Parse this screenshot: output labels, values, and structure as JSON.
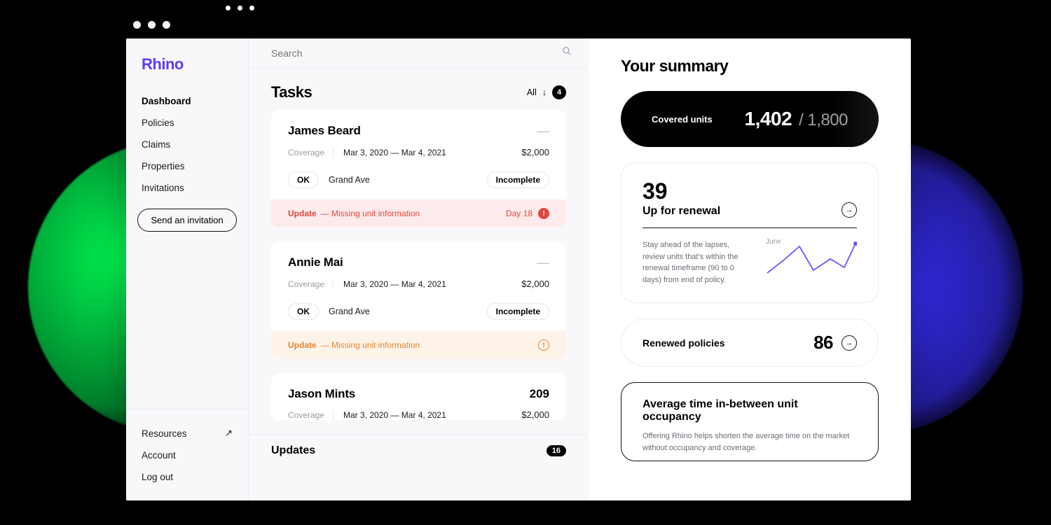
{
  "brand": "Rhino",
  "sidebar": {
    "items": [
      {
        "label": "Dashboard",
        "active": true
      },
      {
        "label": "Policies"
      },
      {
        "label": "Claims"
      },
      {
        "label": "Properties"
      },
      {
        "label": "Invitations"
      }
    ],
    "cta": "Send an invitation",
    "bottom": {
      "resources": "Resources",
      "account": "Account",
      "logout": "Log out"
    }
  },
  "search": {
    "placeholder": "Search"
  },
  "tasks": {
    "title": "Tasks",
    "filter_label": "All",
    "count": "4",
    "items": [
      {
        "name": "James Beard",
        "metric": "—",
        "coverage_label": "Coverage",
        "dates": "Mar 3, 2020 — Mar 4, 2021",
        "amount": "$2,000",
        "status": "OK",
        "address": "Grand Ave",
        "completion": "Incomplete",
        "alert": {
          "type": "red",
          "title": "Update",
          "msg": "— Missing unit information",
          "day": "Day 18"
        }
      },
      {
        "name": "Annie Mai",
        "metric": "—",
        "coverage_label": "Coverage",
        "dates": "Mar 3, 2020 — Mar 4, 2021",
        "amount": "$2,000",
        "status": "OK",
        "address": "Grand Ave",
        "completion": "Incomplete",
        "alert": {
          "type": "orange",
          "title": "Update",
          "msg": "— Missing unit information"
        }
      },
      {
        "name": "Jason Mints",
        "metric": "209",
        "coverage_label": "Coverage",
        "dates": "Mar 3, 2020 — Mar 4, 2021",
        "amount": "$2,000"
      }
    ]
  },
  "updates": {
    "title": "Updates",
    "count": "16"
  },
  "summary": {
    "title": "Your summary",
    "covered": {
      "label": "Covered units",
      "value": "1,402",
      "total": "/ 1,800"
    },
    "renewal": {
      "value": "39",
      "label": "Up for renewal",
      "body": "Stay ahead of the lapses, review units that's within the renewal timeframe (90 to 0 days) from end of policy.",
      "spark_label": "June"
    },
    "renewed": {
      "label": "Renewed policies",
      "value": "86"
    },
    "avg": {
      "title": "Average time in-between unit occupancy",
      "body": "Offering Rhino helps shorten the average time on the market without occupancy and coverage."
    }
  }
}
